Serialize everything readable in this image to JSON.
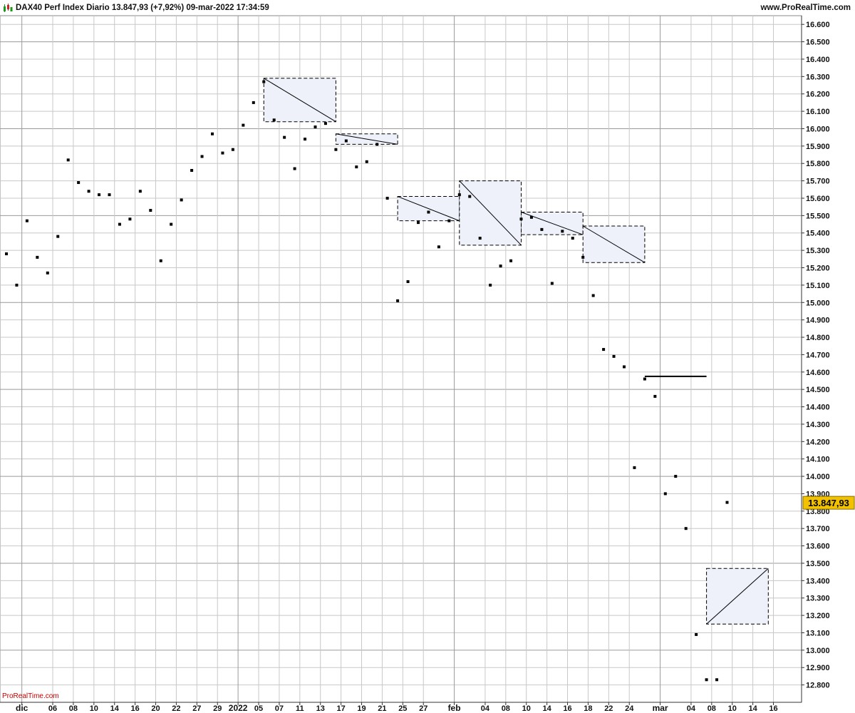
{
  "header": {
    "title": "DAX40 Perf Index Diario 13.847,93 (+7,92%) 09-mar-2022 17:34:59",
    "site": "www.ProRealTime.com"
  },
  "footer": {
    "credit": "ProRealTime.com"
  },
  "colors": {
    "grid": "#c8c8c8",
    "major_grid": "#9a9a9a",
    "point": "#000000",
    "box_fill": "#eef0fa",
    "price_tag": "#f2c200"
  },
  "chart_data": {
    "type": "scatter",
    "title": "DAX40 Perf Index Diario",
    "ylim": [
      12700,
      16650
    ],
    "y_ticks": [
      "16.600",
      "16.500",
      "16.400",
      "16.300",
      "16.200",
      "16.100",
      "16.000",
      "15.900",
      "15.800",
      "15.700",
      "15.600",
      "15.500",
      "15.400",
      "15.300",
      "15.200",
      "15.100",
      "15.000",
      "14.900",
      "14.800",
      "14.700",
      "14.600",
      "14.500",
      "14.400",
      "14.300",
      "14.200",
      "14.100",
      "14.000",
      "13.900",
      "13.800",
      "13.700",
      "13.600",
      "13.500",
      "13.400",
      "13.300",
      "13.200",
      "13.100",
      "13.000",
      "12.900",
      "12.800"
    ],
    "x_ticks": [
      {
        "label": "dic",
        "d": 1.5,
        "major": true
      },
      {
        "label": "06",
        "d": 4.5
      },
      {
        "label": "08",
        "d": 6.5
      },
      {
        "label": "10",
        "d": 8.5
      },
      {
        "label": "14",
        "d": 10.5
      },
      {
        "label": "16",
        "d": 12.5
      },
      {
        "label": "20",
        "d": 14.5
      },
      {
        "label": "22",
        "d": 16.5
      },
      {
        "label": "27",
        "d": 18.5
      },
      {
        "label": "29",
        "d": 20.5
      },
      {
        "label": "2022",
        "d": 22.5,
        "major": true
      },
      {
        "label": "05",
        "d": 24.5
      },
      {
        "label": "07",
        "d": 26.5
      },
      {
        "label": "11",
        "d": 28.5
      },
      {
        "label": "13",
        "d": 30.5
      },
      {
        "label": "17",
        "d": 32.5
      },
      {
        "label": "19",
        "d": 34.5
      },
      {
        "label": "21",
        "d": 36.5
      },
      {
        "label": "25",
        "d": 38.5
      },
      {
        "label": "27",
        "d": 40.5
      },
      {
        "label": "feb",
        "d": 43.5,
        "major": true
      },
      {
        "label": "04",
        "d": 46.5
      },
      {
        "label": "08",
        "d": 48.5
      },
      {
        "label": "10",
        "d": 50.5
      },
      {
        "label": "14",
        "d": 52.5
      },
      {
        "label": "16",
        "d": 54.5
      },
      {
        "label": "18",
        "d": 56.5
      },
      {
        "label": "22",
        "d": 58.5
      },
      {
        "label": "24",
        "d": 60.5
      },
      {
        "label": "mar",
        "d": 63.5,
        "major": true
      },
      {
        "label": "04",
        "d": 66.5
      },
      {
        "label": "08",
        "d": 68.5
      },
      {
        "label": "10",
        "d": 70.5
      },
      {
        "label": "14",
        "d": 72.5
      },
      {
        "label": "16",
        "d": 74.5
      }
    ],
    "series": [
      {
        "values": [
          {
            "d": 0,
            "y": 15280
          },
          {
            "d": 1,
            "y": 15100
          },
          {
            "d": 2,
            "y": 15470
          },
          {
            "d": 3,
            "y": 15260
          },
          {
            "d": 4,
            "y": 15170
          },
          {
            "d": 5,
            "y": 15380
          },
          {
            "d": 6,
            "y": 15820
          },
          {
            "d": 7,
            "y": 15690
          },
          {
            "d": 8,
            "y": 15640
          },
          {
            "d": 9,
            "y": 15620
          },
          {
            "d": 10,
            "y": 15620
          },
          {
            "d": 11,
            "y": 15450
          },
          {
            "d": 12,
            "y": 15480
          },
          {
            "d": 13,
            "y": 15640
          },
          {
            "d": 14,
            "y": 15530
          },
          {
            "d": 15,
            "y": 15240
          },
          {
            "d": 16,
            "y": 15450
          },
          {
            "d": 17,
            "y": 15590
          },
          {
            "d": 18,
            "y": 15760
          },
          {
            "d": 19,
            "y": 15840
          },
          {
            "d": 20,
            "y": 15970
          },
          {
            "d": 21,
            "y": 15860
          },
          {
            "d": 22,
            "y": 15880
          },
          {
            "d": 23,
            "y": 16020
          },
          {
            "d": 24,
            "y": 16150
          },
          {
            "d": 25,
            "y": 16270
          },
          {
            "d": 26,
            "y": 16050
          },
          {
            "d": 27,
            "y": 15950
          },
          {
            "d": 28,
            "y": 15770
          },
          {
            "d": 29,
            "y": 15940
          },
          {
            "d": 30,
            "y": 16010
          },
          {
            "d": 31,
            "y": 16030
          },
          {
            "d": 32,
            "y": 15880
          },
          {
            "d": 33,
            "y": 15930
          },
          {
            "d": 34,
            "y": 15780
          },
          {
            "d": 35,
            "y": 15810
          },
          {
            "d": 36,
            "y": 15910
          },
          {
            "d": 37,
            "y": 15600
          },
          {
            "d": 38,
            "y": 15010
          },
          {
            "d": 39,
            "y": 15120
          },
          {
            "d": 40,
            "y": 15460
          },
          {
            "d": 41,
            "y": 15520
          },
          {
            "d": 42,
            "y": 15320
          },
          {
            "d": 43,
            "y": 15470
          },
          {
            "d": 44,
            "y": 15620
          },
          {
            "d": 45,
            "y": 15610
          },
          {
            "d": 46,
            "y": 15370
          },
          {
            "d": 47,
            "y": 15100
          },
          {
            "d": 48,
            "y": 15210
          },
          {
            "d": 49,
            "y": 15240
          },
          {
            "d": 50,
            "y": 15480
          },
          {
            "d": 51,
            "y": 15490
          },
          {
            "d": 52,
            "y": 15420
          },
          {
            "d": 53,
            "y": 15110
          },
          {
            "d": 54,
            "y": 15410
          },
          {
            "d": 55,
            "y": 15370
          },
          {
            "d": 56,
            "y": 15260
          },
          {
            "d": 57,
            "y": 15040
          },
          {
            "d": 58,
            "y": 14730
          },
          {
            "d": 59,
            "y": 14690
          },
          {
            "d": 60,
            "y": 14630
          },
          {
            "d": 61,
            "y": 14050
          },
          {
            "d": 62,
            "y": 14560
          },
          {
            "d": 63,
            "y": 14460
          },
          {
            "d": 64,
            "y": 13900
          },
          {
            "d": 65,
            "y": 14000
          },
          {
            "d": 66,
            "y": 13700
          },
          {
            "d": 67,
            "y": 13090
          },
          {
            "d": 68,
            "y": 12830
          },
          {
            "d": 69,
            "y": 12830
          },
          {
            "d": 70,
            "y": 13850
          }
        ]
      }
    ],
    "boxes": [
      {
        "d0": 25,
        "d1": 32,
        "y0": 16040,
        "y1": 16290,
        "diag": "down"
      },
      {
        "d0": 32,
        "d1": 38,
        "y0": 15910,
        "y1": 15970,
        "diag": "down"
      },
      {
        "d0": 38,
        "d1": 44,
        "y0": 15470,
        "y1": 15610,
        "diag": "down"
      },
      {
        "d0": 44,
        "d1": 50,
        "y0": 15330,
        "y1": 15700,
        "diag": "down"
      },
      {
        "d0": 50,
        "d1": 56,
        "y0": 15390,
        "y1": 15520,
        "diag": "down"
      },
      {
        "d0": 56,
        "d1": 62,
        "y0": 15230,
        "y1": 15440,
        "diag": "down"
      },
      {
        "d0": 62,
        "d1": 68,
        "y0": 14570,
        "y1": 14580,
        "diag": "flat"
      },
      {
        "d0": 68,
        "d1": 74,
        "y0": 13150,
        "y1": 13470,
        "diag": "up"
      }
    ],
    "last_price": "13.847,93",
    "last_value": 13847.93
  }
}
